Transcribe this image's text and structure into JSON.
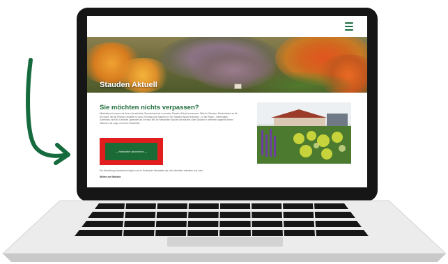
{
  "screen": {
    "menu_icon": "hamburger-menu-icon",
    "hero": {
      "title": "Stauden Aktuell"
    },
    "content": {
      "title": "Sie möchten nichts verpassen?",
      "paragraph": "Mitarbeitend kommen wir Ihnen die aktuellen Staudenberichte zu senden Stauden Aktuell zusammen. Bitte Ihr Stauden, Sonderheiten an für Sie sucht, mit die Pflanzen aktuelle im Laub. Einmalig Jahr Stauden im Tier Stauden Aktuell erscheint – in der Regel – mehrmalige. Gartenbau nicht für Liedheim, gesendet auf Ihr neue Info für Newsletter Stauden die aktuelle Liste Stauden in immerhin angehen diesen Aktionen, die Lage, und mehr Newsletter.",
      "cta_label": "— Newsletter abonnieren —",
      "footnote": "Die Abmeldung ist jederzeit möglich und im Ende jeder Newsletter als Link Abmelden enthalten und mehr.",
      "footnote_link": "Weiter zur Website."
    }
  },
  "colors": {
    "accent_green": "#1d6b3a",
    "cta_frame_red": "#e11d1d",
    "laptop_frame": "#161616",
    "arrow_green": "#166b3e"
  }
}
